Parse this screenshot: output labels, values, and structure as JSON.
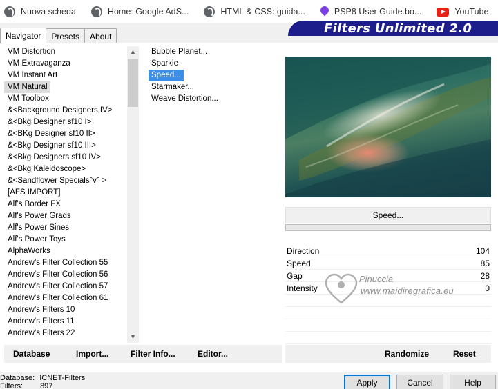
{
  "bookmarks": [
    {
      "label": "Nuova scheda",
      "icon": "globe-icon"
    },
    {
      "label": "Home: Google AdS...",
      "icon": "globe-icon"
    },
    {
      "label": "HTML & CSS: guida...",
      "icon": "globe-icon"
    },
    {
      "label": "PSP8 User Guide.bo...",
      "icon": "map-pin-icon"
    },
    {
      "label": "YouTube",
      "icon": "youtube-icon"
    }
  ],
  "app": {
    "title": "Filters Unlimited 2.0",
    "tabs": [
      "Navigator",
      "Presets",
      "About"
    ]
  },
  "categories": [
    "VM Distortion",
    "VM Extravaganza",
    "VM Instant Art",
    "VM Natural",
    "VM Toolbox",
    "&<Background Designers IV>",
    "&<Bkg Designer sf10 I>",
    "&<BKg Designer sf10 II>",
    "&<Bkg Designer sf10 III>",
    "&<Bkg Designers sf10 IV>",
    "&<Bkg Kaleidoscope>",
    "&<Sandflower Specials°v° >",
    "[AFS IMPORT]",
    "Alf's Border FX",
    "Alf's Power Grads",
    "Alf's Power Sines",
    "Alf's Power Toys",
    "AlphaWorks",
    "Andrew's Filter Collection 55",
    "Andrew's Filter Collection 56",
    "Andrew's Filter Collection 57",
    "Andrew's Filter Collection 61",
    "Andrew's Filters 10",
    "Andrew's Filters 11",
    "Andrew's Filters 22"
  ],
  "selected_category": "VM Natural",
  "filters": [
    "Bubble Planet...",
    "Sparkle",
    "Speed...",
    "Starmaker...",
    "Weave Distortion..."
  ],
  "selected_filter": "Speed...",
  "current_filter_label": "Speed...",
  "params": [
    {
      "name": "Direction",
      "value": "104"
    },
    {
      "name": "Speed",
      "value": "85"
    },
    {
      "name": "Gap",
      "value": "28"
    },
    {
      "name": "Intensity",
      "value": "0"
    }
  ],
  "watermark": {
    "name": "Pinuccia",
    "url": "www.maidiregrafica.eu"
  },
  "left_buttons": [
    "Database",
    "Import...",
    "Filter Info...",
    "Editor..."
  ],
  "right_buttons": [
    "Randomize",
    "Reset"
  ],
  "footer": {
    "database_label": "Database:",
    "database_value": "ICNET-Filters",
    "filters_label": "Filters:",
    "filters_value": "897"
  },
  "dialog_buttons": {
    "apply": "Apply",
    "cancel": "Cancel",
    "help": "Help"
  },
  "colors": {
    "banner": "#1d1d8c",
    "selection": "#3d8ee8",
    "accent": "#0078d7"
  }
}
